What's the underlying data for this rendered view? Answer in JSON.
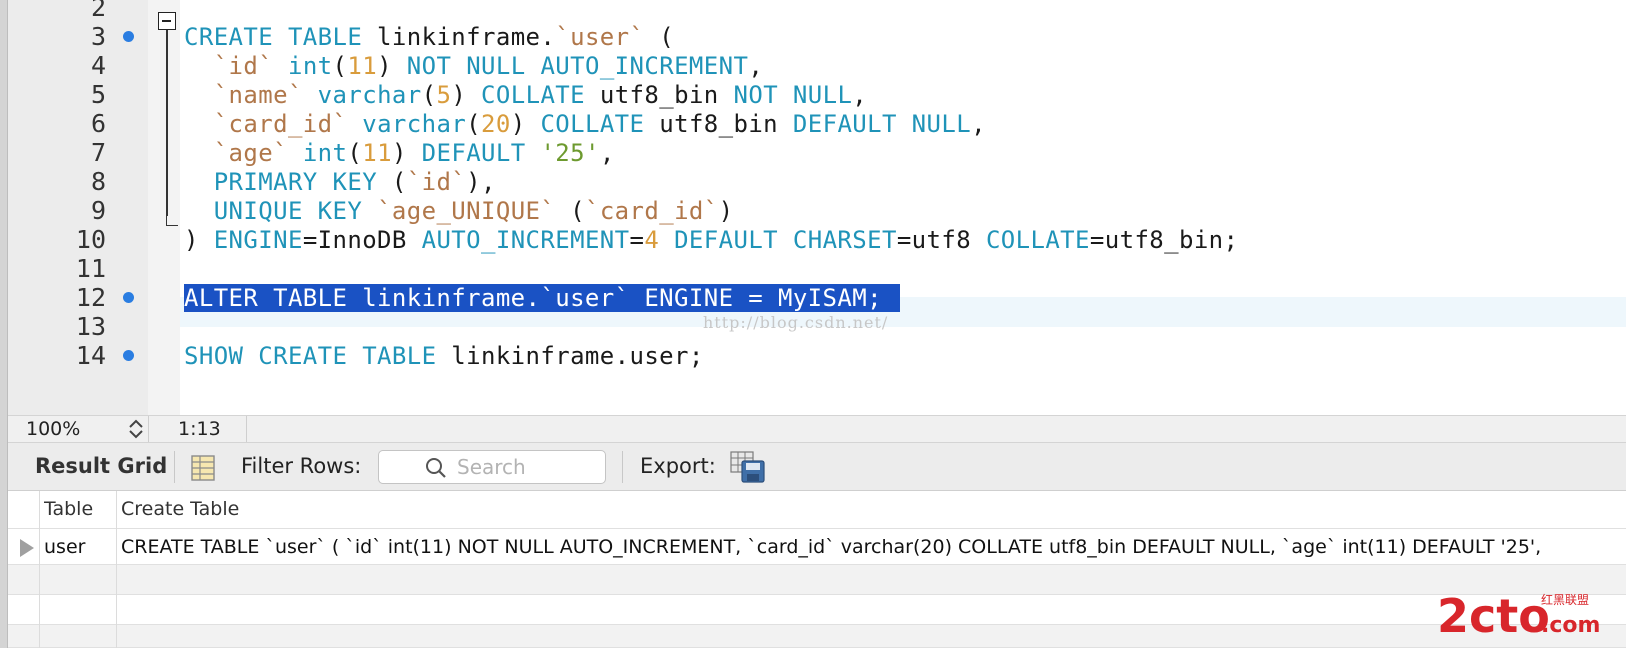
{
  "editor": {
    "line_numbers": [
      "2",
      "3",
      "4",
      "5",
      "6",
      "7",
      "8",
      "9",
      "10",
      "11",
      "12",
      "13",
      "14"
    ],
    "lines": [
      [],
      [
        {
          "t": "CREATE TABLE",
          "c": "kw"
        },
        {
          "t": " linkinframe."
        },
        {
          "t": "`user`",
          "c": "bq"
        },
        {
          "t": " ("
        }
      ],
      [
        {
          "t": "  "
        },
        {
          "t": "`id`",
          "c": "bq"
        },
        {
          "t": " "
        },
        {
          "t": "int",
          "c": "kw"
        },
        {
          "t": "("
        },
        {
          "t": "11",
          "c": "num"
        },
        {
          "t": ") "
        },
        {
          "t": "NOT NULL AUTO_INCREMENT",
          "c": "kw"
        },
        {
          "t": ","
        }
      ],
      [
        {
          "t": "  "
        },
        {
          "t": "`name`",
          "c": "bq"
        },
        {
          "t": " "
        },
        {
          "t": "varchar",
          "c": "kw"
        },
        {
          "t": "("
        },
        {
          "t": "5",
          "c": "num"
        },
        {
          "t": ") "
        },
        {
          "t": "COLLATE",
          "c": "kw"
        },
        {
          "t": " utf8_bin "
        },
        {
          "t": "NOT NULL",
          "c": "kw"
        },
        {
          "t": ","
        }
      ],
      [
        {
          "t": "  "
        },
        {
          "t": "`card_id`",
          "c": "bq"
        },
        {
          "t": " "
        },
        {
          "t": "varchar",
          "c": "kw"
        },
        {
          "t": "("
        },
        {
          "t": "20",
          "c": "num"
        },
        {
          "t": ") "
        },
        {
          "t": "COLLATE",
          "c": "kw"
        },
        {
          "t": " utf8_bin "
        },
        {
          "t": "DEFAULT NULL",
          "c": "kw"
        },
        {
          "t": ","
        }
      ],
      [
        {
          "t": "  "
        },
        {
          "t": "`age`",
          "c": "bq"
        },
        {
          "t": " "
        },
        {
          "t": "int",
          "c": "kw"
        },
        {
          "t": "("
        },
        {
          "t": "11",
          "c": "num"
        },
        {
          "t": ") "
        },
        {
          "t": "DEFAULT",
          "c": "kw"
        },
        {
          "t": " "
        },
        {
          "t": "'25'",
          "c": "str"
        },
        {
          "t": ","
        }
      ],
      [
        {
          "t": "  "
        },
        {
          "t": "PRIMARY KEY",
          "c": "kw"
        },
        {
          "t": " ("
        },
        {
          "t": "`id`",
          "c": "bq"
        },
        {
          "t": "),"
        }
      ],
      [
        {
          "t": "  "
        },
        {
          "t": "UNIQUE KEY",
          "c": "kw"
        },
        {
          "t": " "
        },
        {
          "t": "`age_UNIQUE`",
          "c": "bq"
        },
        {
          "t": " ("
        },
        {
          "t": "`card_id`",
          "c": "bq"
        },
        {
          "t": ")"
        }
      ],
      [
        {
          "t": ") "
        },
        {
          "t": "ENGINE",
          "c": "kw"
        },
        {
          "t": "=InnoDB "
        },
        {
          "t": "AUTO_INCREMENT",
          "c": "kw"
        },
        {
          "t": "="
        },
        {
          "t": "4",
          "c": "num"
        },
        {
          "t": " "
        },
        {
          "t": "DEFAULT CHARSET",
          "c": "kw"
        },
        {
          "t": "=utf8 "
        },
        {
          "t": "COLLATE",
          "c": "kw"
        },
        {
          "t": "=utf8_bin;"
        }
      ],
      [],
      [
        {
          "t": "ALTER TABLE linkinframe.`user` ENGINE = MyISAM;",
          "c": "sel"
        }
      ],
      [],
      [
        {
          "t": "SHOW CREATE TABLE",
          "c": "kw"
        },
        {
          "t": " linkinframe.user;"
        }
      ]
    ],
    "breakpoint_lines": [
      "3",
      "12",
      "14"
    ],
    "watermark": "http://blog.csdn.net/"
  },
  "status": {
    "zoom": "100%",
    "cursor_position": "1:13"
  },
  "toolbar": {
    "result_grid_label": "Result Grid",
    "filter_rows_label": "Filter Rows:",
    "search_placeholder": "Search",
    "export_label": "Export:"
  },
  "grid": {
    "columns": [
      "Table",
      "Create Table"
    ],
    "rows": [
      [
        "user",
        "CREATE TABLE `user` (   `id` int(11) NOT NULL AUTO_INCREMENT,   `card_id` varchar(20) COLLATE utf8_bin DEFAULT NULL,   `age` int(11) DEFAULT '25',"
      ]
    ]
  },
  "logo": {
    "text": "2cto",
    "suffix": ".com",
    "tagline": "红黑联盟",
    "color": "#d8262b"
  }
}
